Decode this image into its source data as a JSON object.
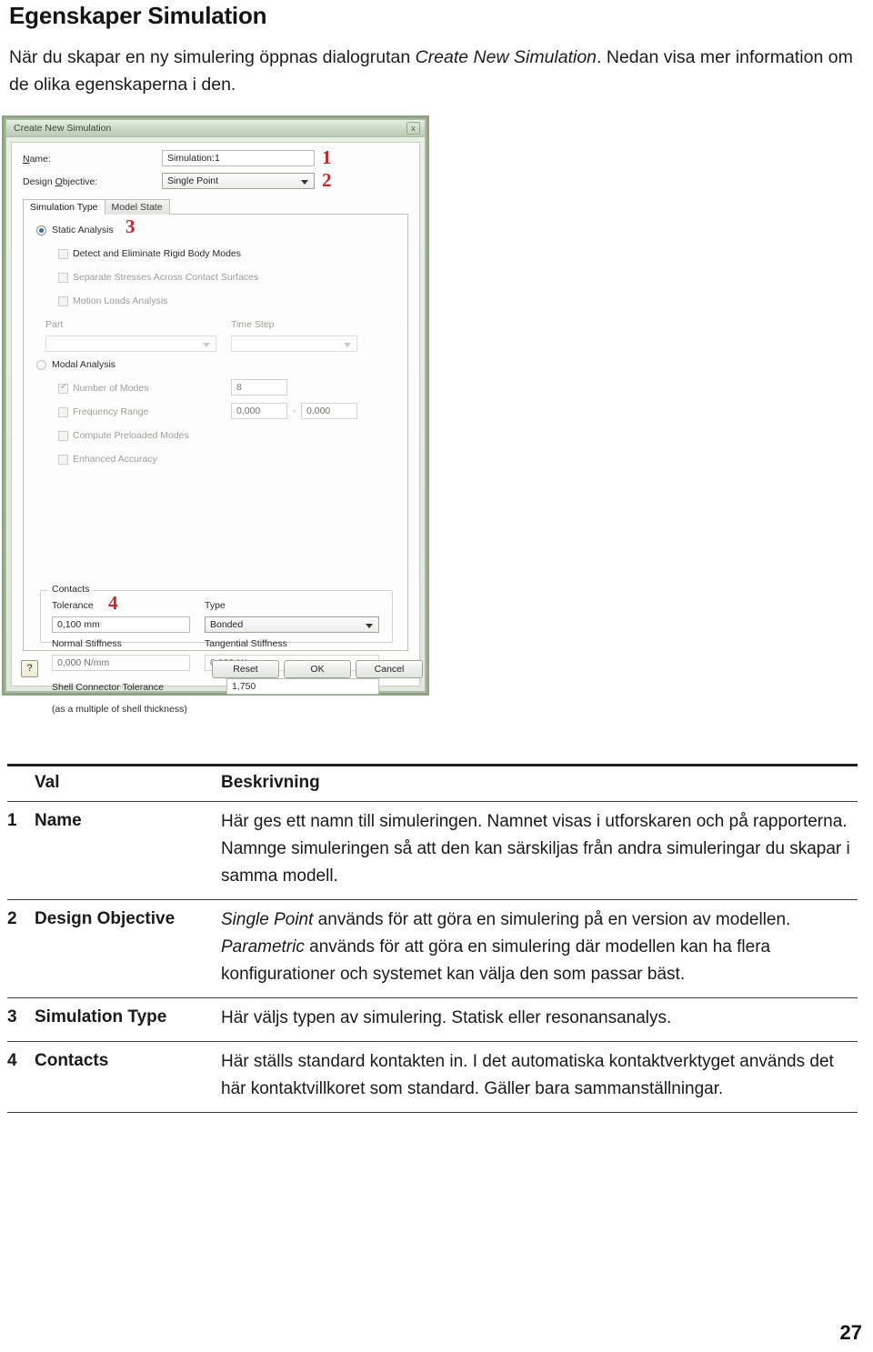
{
  "document": {
    "title": "Egenskaper Simulation",
    "intro_before": "När du skapar en ny simulering öppnas dialogrutan ",
    "intro_italic": "Create New Simulation",
    "intro_after": ". Nedan visa mer information om de olika egenskaperna i den.",
    "page_number": "27"
  },
  "dialog": {
    "titlebar": "Create New Simulation",
    "close_label": "x",
    "name_label": "Name:",
    "name_value": "Simulation:1",
    "design_objective_label": "Design Objective:",
    "design_objective_value": "Single Point",
    "tabs": [
      {
        "label": "Simulation Type",
        "active": true
      },
      {
        "label": "Model State",
        "active": false
      }
    ],
    "static_analysis": "Static Analysis",
    "detect_eliminate": "Detect and Eliminate Rigid Body Modes",
    "separate_stresses": "Separate Stresses Across Contact Surfaces",
    "motion_loads": "Motion Loads Analysis",
    "part_label": "Part",
    "part_value": "",
    "time_step_label": "Time Step",
    "time_step_value": "",
    "modal_analysis": "Modal Analysis",
    "number_of_modes": "Number of Modes",
    "number_of_modes_value": "8",
    "frequency_range": "Frequency Range",
    "frequency_min": "0,000",
    "frequency_sep": "-",
    "frequency_max": "0,000",
    "compute_preloaded": "Compute Preloaded Modes",
    "enhanced_accuracy": "Enhanced Accuracy",
    "contacts_group": "Contacts",
    "tolerance_label": "Tolerance",
    "tolerance_value": "0,100 mm",
    "type_label": "Type",
    "type_value": "Bonded",
    "normal_stiffness_label": "Normal Stiffness",
    "normal_stiffness_value": "0,000 N/mm",
    "tangential_stiffness_label": "Tangential Stiffness",
    "tangential_stiffness_value": "0,000 N/mm",
    "shell_connector_label": "Shell Connector Tolerance",
    "shell_connector_sub": "(as a multiple of shell thickness)",
    "shell_connector_value": "1,750",
    "help_glyph": "?",
    "reset_label": "Reset",
    "ok_label": "OK",
    "cancel_label": "Cancel",
    "annotations": [
      "1",
      "2",
      "3",
      "4"
    ],
    "annotation_color": "#d52027",
    "titlebar_color": "#b9cbb0",
    "frame_color": "#8ea582"
  },
  "table": {
    "headers": {
      "num": "",
      "option": "Val",
      "description": "Beskrivning"
    },
    "rows": [
      {
        "num": "1",
        "option": "Name",
        "desc_parts": [
          {
            "style": "normal",
            "text": "Här ges ett namn till simuleringen. Namnet visas i utforskaren och på rapporterna. Namnge simuleringen så att den kan särskiljas från andra simuleringar du skapar i samma modell."
          }
        ]
      },
      {
        "num": "2",
        "option": "Design Objective",
        "desc_parts": [
          {
            "style": "italic",
            "text": "Single Point"
          },
          {
            "style": "normal",
            "text": " används för att göra en simulering på en version av modellen. "
          },
          {
            "style": "italic",
            "text": "Parametric"
          },
          {
            "style": "normal",
            "text": " används för att göra en simulering där modellen kan ha flera konfigurationer och systemet kan välja den som passar bäst."
          }
        ]
      },
      {
        "num": "3",
        "option": "Simulation Type",
        "desc_parts": [
          {
            "style": "normal",
            "text": "Här väljs typen av simulering. Statisk eller resonansanalys."
          }
        ]
      },
      {
        "num": "4",
        "option": "Contacts",
        "desc_parts": [
          {
            "style": "normal",
            "text": "Här ställs standard kontakten in. I det automatiska kontaktverktyget används det här kontaktvillkoret som standard. Gäller bara sammanställningar."
          }
        ]
      }
    ]
  }
}
